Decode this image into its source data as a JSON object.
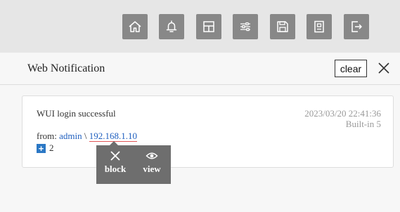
{
  "toolbar": {
    "buttons": [
      {
        "icon": "home-icon"
      },
      {
        "icon": "bell-icon"
      },
      {
        "icon": "dashboard-layout-icon"
      },
      {
        "icon": "sliders-icon"
      },
      {
        "icon": "save-icon"
      },
      {
        "icon": "device-icon"
      },
      {
        "icon": "logout-icon"
      }
    ]
  },
  "panel": {
    "title": "Web Notification",
    "clear_label": "clear",
    "close_icon": "close-icon"
  },
  "notification": {
    "message": "WUI login successful",
    "timestamp": "2023/03/20 22:41:36",
    "source": "Built-in 5",
    "from_prefix": "from: ",
    "user": "admin",
    "separator": " \\ ",
    "ip": "192.168.1.10",
    "count": "2"
  },
  "popup": {
    "block_label": "block",
    "view_label": "view"
  },
  "colors": {
    "toolbar_bg": "#e6e6e6",
    "button_bg": "#888888",
    "link": "#1f5fbf",
    "accent_underline": "#e05555",
    "popup_bg": "#6e6e6e"
  }
}
